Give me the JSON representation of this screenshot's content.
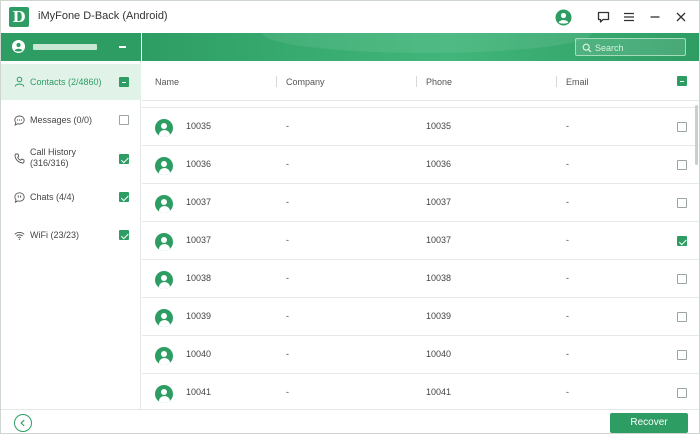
{
  "app": {
    "title": "iMyFone D-Back (Android)",
    "logo_letter": "D"
  },
  "colors": {
    "accent": "#2e9d64",
    "active_bg": "#e1f2e8"
  },
  "titlebar_icons": [
    "user-account-icon",
    "feedback-icon",
    "menu-icon",
    "minimize-icon",
    "close-icon"
  ],
  "sidebar": {
    "categories": [
      {
        "label": "Contacts (2/4860)",
        "icon": "contact-icon",
        "state": "partial",
        "active": true
      },
      {
        "label": "Messages (0/0)",
        "icon": "message-icon",
        "state": "unchecked",
        "active": false
      },
      {
        "label_line1": "Call History",
        "label_line2": "(316/316)",
        "icon": "phone-icon",
        "state": "checked",
        "active": false
      },
      {
        "label": "Chats (4/4)",
        "icon": "chat-icon",
        "state": "checked",
        "active": false
      },
      {
        "label": "WiFi (23/23)",
        "icon": "wifi-icon",
        "state": "checked",
        "active": false
      }
    ]
  },
  "search": {
    "placeholder": "Search"
  },
  "table": {
    "columns": [
      "Name",
      "Company",
      "Phone",
      "Email"
    ],
    "header_state": "partial",
    "rows": [
      {
        "name": "10035",
        "company": "-",
        "phone": "10035",
        "email": "-",
        "checked": false
      },
      {
        "name": "10036",
        "company": "-",
        "phone": "10036",
        "email": "-",
        "checked": false
      },
      {
        "name": "10037",
        "company": "-",
        "phone": "10037",
        "email": "-",
        "checked": false
      },
      {
        "name": "10037",
        "company": "-",
        "phone": "10037",
        "email": "-",
        "checked": true
      },
      {
        "name": "10038",
        "company": "-",
        "phone": "10038",
        "email": "-",
        "checked": false
      },
      {
        "name": "10039",
        "company": "-",
        "phone": "10039",
        "email": "-",
        "checked": false
      },
      {
        "name": "10040",
        "company": "-",
        "phone": "10040",
        "email": "-",
        "checked": false
      },
      {
        "name": "10041",
        "company": "-",
        "phone": "10041",
        "email": "-",
        "checked": false
      }
    ]
  },
  "footer": {
    "recover_label": "Recover"
  }
}
